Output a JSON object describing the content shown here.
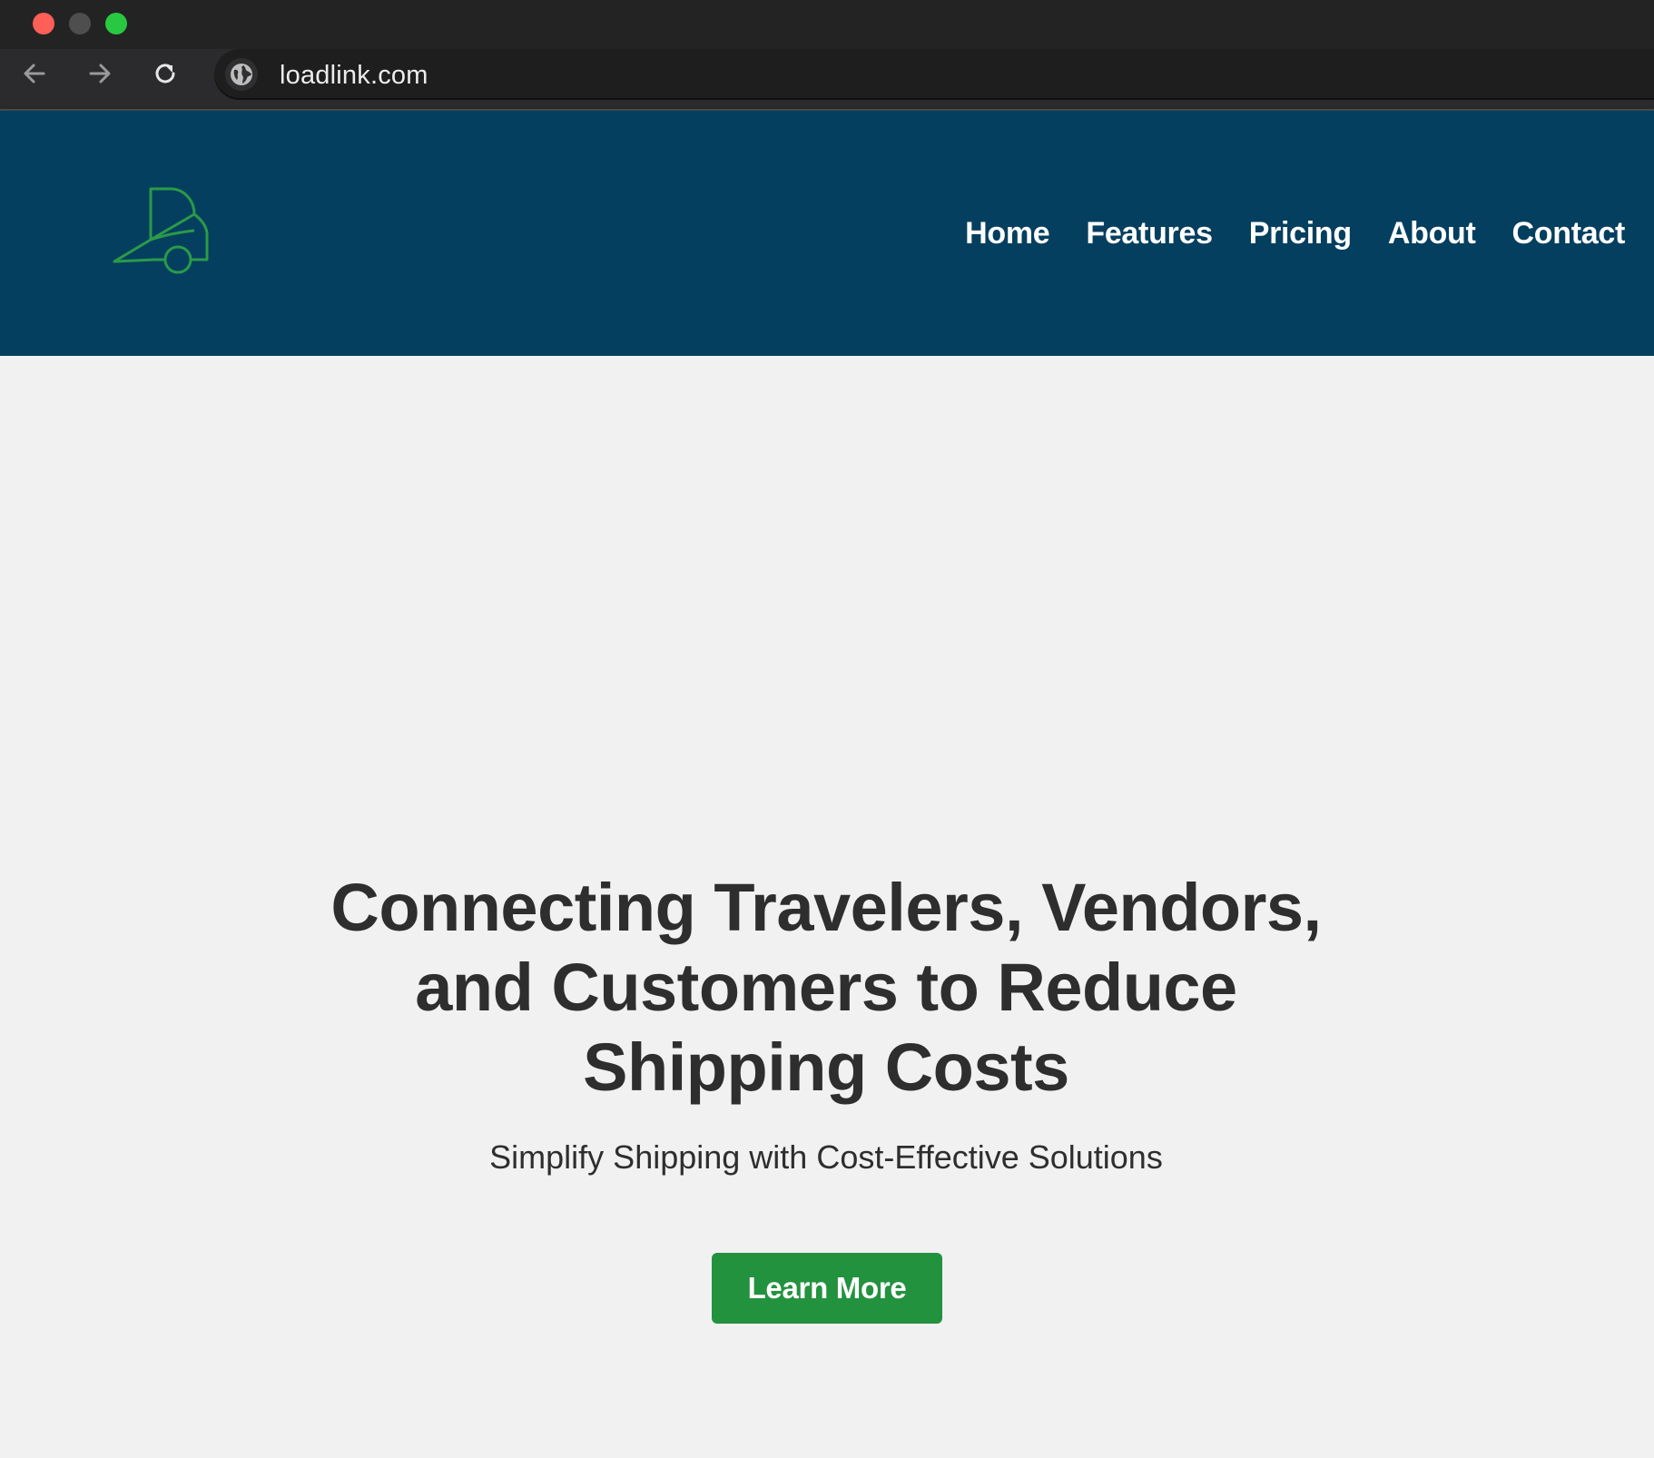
{
  "browser": {
    "url": "loadlink.com",
    "back_icon": "arrow-left-icon",
    "forward_icon": "arrow-right-icon",
    "reload_icon": "reload-icon",
    "site_icon": "globe-icon"
  },
  "header": {
    "logo_icon": "delivery-vehicle-icon",
    "nav": {
      "home": "Home",
      "features": "Features",
      "pricing": "Pricing",
      "about": "About",
      "contact": "Contact"
    }
  },
  "hero": {
    "title": "Connecting Travelers, Vendors, and Customers to Reduce Shipping Costs",
    "subtitle": "Simplify Shipping with Cost-Effective Solutions",
    "cta_label": "Learn More"
  },
  "colors": {
    "header_bg": "#053f5f",
    "accent_green": "#23923f",
    "page_bg": "#f1f1f1",
    "text_dark": "#2e2e2e"
  }
}
